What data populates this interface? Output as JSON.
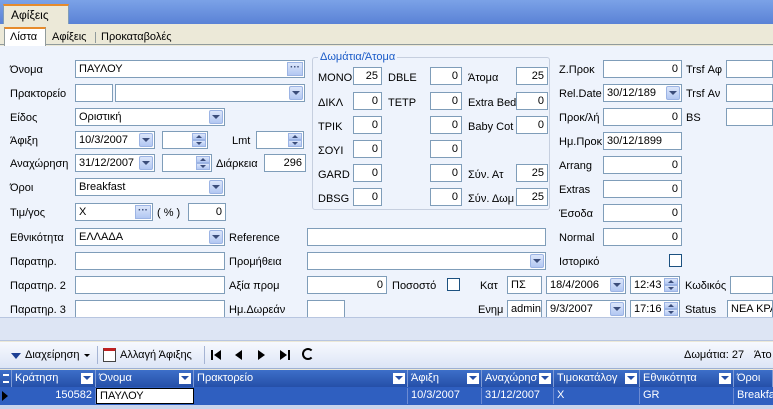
{
  "window": {
    "tab": "Αφίξεις"
  },
  "subtabs": [
    "Λίστα",
    "Αφίξεις",
    "Προκαταβολές"
  ],
  "form": {
    "name_label": "Όνομα",
    "name_value": "ΠΑΥΛΟΥ",
    "agency_label": "Πρακτορείο",
    "type_label": "Είδος",
    "type_value": "Οριστική",
    "arrival_label": "Άφιξη",
    "arrival_value": "10/3/2007",
    "lmt_label": "Lmt",
    "departure_label": "Αναχώρηση",
    "departure_value": "31/12/2007",
    "duration_label": "Διάρκεια",
    "duration_value": "296",
    "terms_label": "Όροι",
    "terms_value": "Breakfast",
    "pricelist_label": "Τιμ/γος",
    "pricelist_value": "X",
    "pricelist_pct": "( % )",
    "pricelist_num": "0",
    "nationality_label": "Εθνικότητα",
    "nationality_value": "ΕΛΛΑΔΑ",
    "reference_label": "Reference",
    "remark_label": "Παρατηρ.",
    "commission_label": "Προμήθεια",
    "remark2_label": "Παρατηρ. 2",
    "disc_value_label": "Αξία προμ",
    "disc_value": "0",
    "percent_label": "Ποσοστό",
    "remark3_label": "Παρατηρ. 3",
    "free_nights_label": "Ημ.Δωρεάν"
  },
  "rooms": {
    "legend": "Δωμάτια/Άτομα",
    "mono_label": "MONO",
    "mono": "25",
    "dble_label": "DBLE",
    "dble": "0",
    "atoma_label": "Άτομα",
    "atoma": "25",
    "dikl_label": "ΔΙΚΛ",
    "dikl": "0",
    "tetp_label": "TETP",
    "tetp": "0",
    "extrabed_label": "Extra Bed",
    "extrabed": "0",
    "trik_label": "TPIK",
    "trik": "0",
    "empty1": "0",
    "babycot_label": "Baby Cot",
    "babycot": "0",
    "soyi_label": "ΣΟΥΙ",
    "soyi": "0",
    "empty2": "0",
    "gard_label": "GARD",
    "gard": "0",
    "empty3": "0",
    "syn_at_label": "Σύν. Ατ",
    "syn_at": "25",
    "dbsg_label": "DBSG",
    "dbsg": "0",
    "empty4": "0",
    "syn_dom_label": "Σύν. Δωμ",
    "syn_dom": "25"
  },
  "right": {
    "zprok_label": "Z.Προκ",
    "zprok": "0",
    "trsf_af_label": "Trsf Αφ",
    "reldate_label": "Rel.Date",
    "reldate": "30/12/189",
    "trsf_an_label": "Trsf Αν",
    "prokli_label": "Προκ/λή",
    "prokli": "0",
    "bs_label": "BS",
    "improk_label": "Ημ.Προκ",
    "improk": "30/12/1899",
    "arrang_label": "Arrang",
    "arrang": "0",
    "extras_label": "Extras",
    "extras": "0",
    "esoda_label": "Έσοδα",
    "esoda": "0",
    "normal_label": "Normal",
    "normal": "0",
    "history_label": "Ιστορικό",
    "kat_label": "Κατ",
    "kat": "ΠΣ",
    "kat_date": "18/4/2006",
    "kat_time": "12:43",
    "code_label": "Κωδικός",
    "enim_label": "Ενημ",
    "enim": "admin",
    "enim_date": "9/3/2007",
    "enim_time": "17:16",
    "status_label": "Status",
    "status": "ΝΕΑ ΚΡΑ"
  },
  "toolbar": {
    "manage": "Διαχείρηση",
    "change": "Αλλαγή Άφιξης",
    "rooms_count": "Δωμάτια: 27",
    "atoma_short": "Άτο"
  },
  "grid": {
    "headers": [
      "Κράτηση",
      "Όνομα",
      "Πρακτορείο",
      "Άφιξη",
      "Αναχώρησ",
      "Τιμοκατάλογ",
      "Εθνικότητα",
      "Όροι"
    ],
    "row": [
      "150582",
      "ΠΑΥΛΟΥ",
      "",
      "10/3/2007",
      "31/12/2007",
      "X",
      "GR",
      "Breakfa"
    ]
  }
}
